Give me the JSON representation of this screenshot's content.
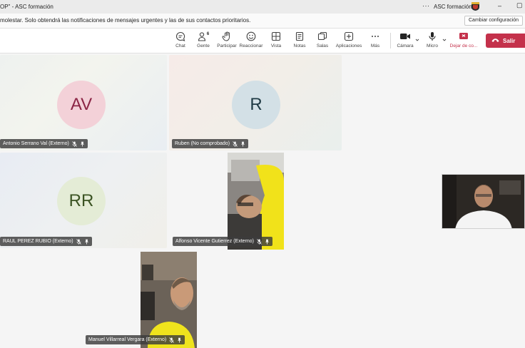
{
  "titlebar": {
    "title_fragment": "OP\" - ASC formación",
    "more_label": "···",
    "org_name": "ASC formación"
  },
  "banner": {
    "message": "molestar. Solo obtendrá las notificaciones de mensajes urgentes y las de sus contactos prioritarios.",
    "settings_button": "Cambiar configuración"
  },
  "toolbar": {
    "chat": "Chat",
    "people": "Gente",
    "people_count": "6",
    "raise": "Participar",
    "react": "Reaccionar",
    "view": "Vista",
    "notes": "Notas",
    "rooms": "Salas",
    "apps": "Aplicaciones",
    "more": "Más",
    "camera": "Cámara",
    "mic": "Micro",
    "share": "Dejar de co...",
    "leave": "Salir"
  },
  "colors": {
    "leave_red": "#c4314b",
    "av_bg": "#f3d1d8",
    "av_fg": "#8b2545",
    "r_bg": "#d3e0e6",
    "r_fg": "#1f3a44",
    "rr_bg": "#e4ecd6",
    "rr_fg": "#3b5323"
  },
  "participants": [
    {
      "initials": "AV",
      "name": "Antonio Serrano Val (Externo)"
    },
    {
      "initials": "R",
      "name": "Ruben (No comprobado)"
    },
    {
      "initials": "RR",
      "name": "RAUL PEREZ RUBIO (Externo)"
    },
    {
      "initials": "",
      "name": "Alfonso Vicente Gutierrez (Externo)"
    },
    {
      "initials": "",
      "name": "Manuel Villarreal Vergara (Externo)"
    }
  ]
}
